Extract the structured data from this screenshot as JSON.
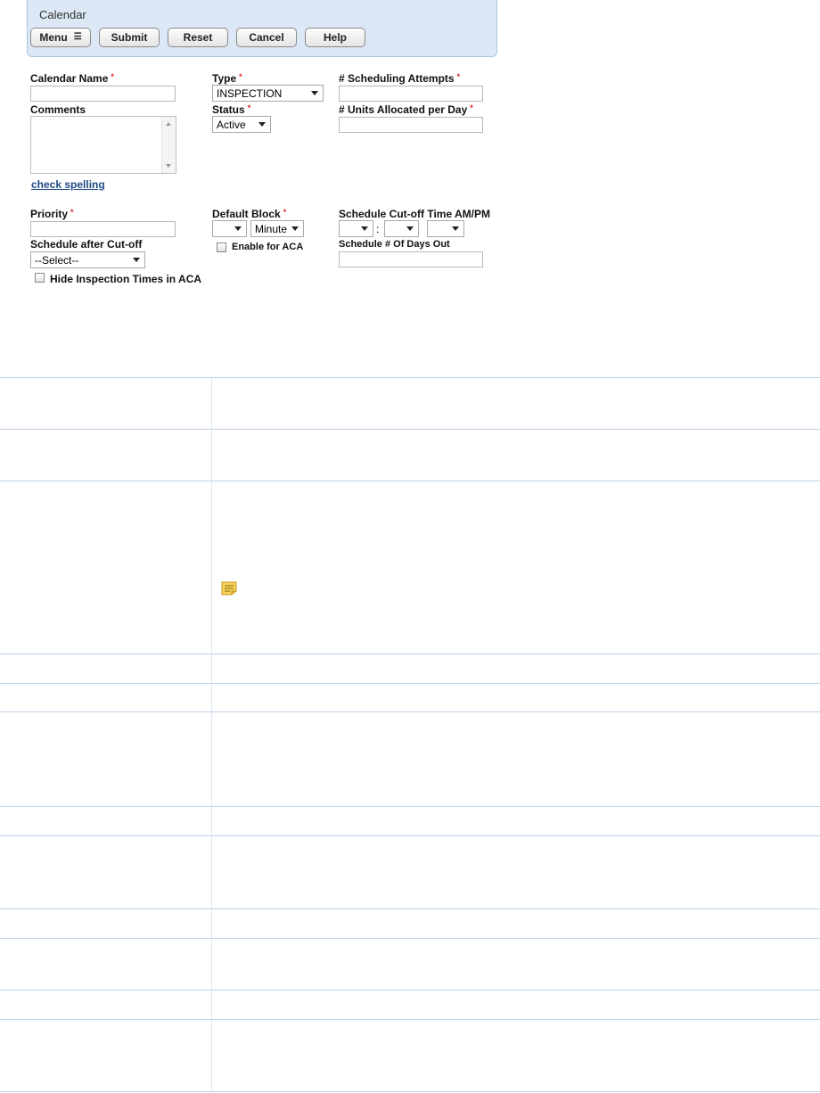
{
  "header": {
    "title": "Calendar",
    "buttons": {
      "menu": "Menu",
      "submit": "Submit",
      "reset": "Reset",
      "cancel": "Cancel",
      "help": "Help"
    }
  },
  "form": {
    "calendar_name": {
      "label": "Calendar Name",
      "value": ""
    },
    "type": {
      "label": "Type",
      "value": "INSPECTION"
    },
    "scheduling_attempts": {
      "label": "# Scheduling Attempts",
      "value": ""
    },
    "comments": {
      "label": "Comments",
      "value": ""
    },
    "status": {
      "label": "Status",
      "value": "Active"
    },
    "units_per_day": {
      "label": "# Units Allocated per Day",
      "value": ""
    },
    "check_spelling": "check spelling",
    "priority": {
      "label": "Priority",
      "value": ""
    },
    "default_block": {
      "label": "Default Block",
      "value": "",
      "unit": "Minute"
    },
    "cutoff_time": {
      "label": "Schedule Cut-off Time  AM/PM",
      "separator": ":"
    },
    "schedule_after_cutoff": {
      "label": "Schedule after Cut-off",
      "value": "--Select--"
    },
    "enable_aca": {
      "label": "Enable for ACA",
      "checked": false
    },
    "days_out": {
      "label": "Schedule # Of Days Out",
      "value": ""
    },
    "hide_times": {
      "label": "Hide Inspection Times in ACA",
      "checked": false
    },
    "required_marker": "*"
  },
  "icons": {
    "note": "note-icon"
  },
  "colors": {
    "header_bg": "#dce8f6",
    "required": "#dd2222",
    "link": "#1f4a86",
    "grid_line": "#bcd0e8",
    "note_icon": "#f5c842"
  }
}
